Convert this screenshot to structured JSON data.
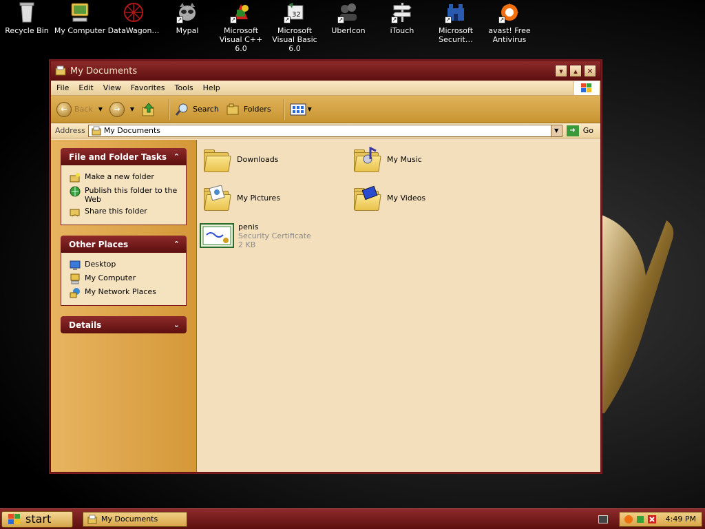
{
  "desktop": {
    "icons": [
      {
        "label": "Recycle Bin",
        "icon": "recycle-bin-icon"
      },
      {
        "label": "My Computer",
        "icon": "computer-icon"
      },
      {
        "label": "DataWagon…",
        "icon": "datawagon-icon"
      },
      {
        "label": "Mypal",
        "icon": "mypal-icon"
      },
      {
        "label": "Microsoft Visual C++ 6.0",
        "icon": "visual-cpp-icon"
      },
      {
        "label": "Microsoft Visual Basic 6.0",
        "icon": "visual-basic-icon"
      },
      {
        "label": "UberIcon",
        "icon": "ubericon-icon"
      },
      {
        "label": "iTouch",
        "icon": "itouch-icon"
      },
      {
        "label": "Microsoft Securit…",
        "icon": "security-icon"
      },
      {
        "label": "avast! Free Antivirus",
        "icon": "avast-icon"
      }
    ]
  },
  "window": {
    "title": "My Documents",
    "menu": [
      "File",
      "Edit",
      "View",
      "Favorites",
      "Tools",
      "Help"
    ],
    "toolbar": {
      "back": "Back",
      "search": "Search",
      "folders": "Folders"
    },
    "address": {
      "label": "Address",
      "value": "My Documents",
      "go": "Go"
    },
    "tasks": {
      "file_folder": {
        "title": "File and Folder Tasks",
        "items": [
          "Make a new folder",
          "Publish this folder to the Web",
          "Share this folder"
        ]
      },
      "other_places": {
        "title": "Other Places",
        "items": [
          "Desktop",
          "My Computer",
          "My Network Places"
        ]
      },
      "details": {
        "title": "Details"
      }
    },
    "files": [
      {
        "name": "Downloads",
        "type": "folder"
      },
      {
        "name": "My Music",
        "type": "folder"
      },
      {
        "name": "My Pictures",
        "type": "folder"
      },
      {
        "name": "My Videos",
        "type": "folder"
      },
      {
        "name": "penis",
        "subtype": "Security Certificate",
        "size": "2 KB",
        "type": "certificate"
      }
    ]
  },
  "taskbar": {
    "start": "start",
    "task": "My Documents",
    "clock": "4:49 PM"
  }
}
